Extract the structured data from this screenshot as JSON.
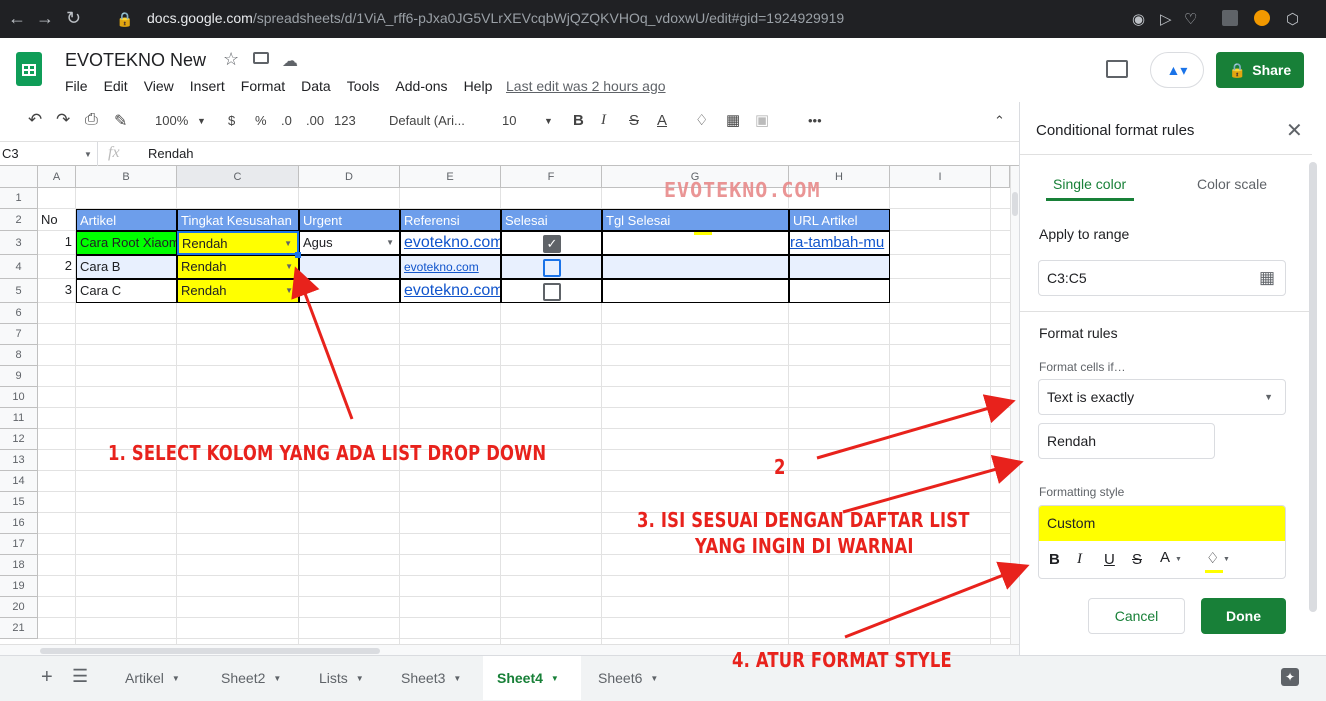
{
  "browser": {
    "url_domain": "docs.google.com",
    "url_path": "/spreadsheets/d/1ViA_rff6-pJxa0JG5VLrXEVcqbWjQZQKVHOq_vdoxwU/edit#gid=1924929919"
  },
  "header": {
    "title": "EVOTEKNO New",
    "menus": [
      "File",
      "Edit",
      "View",
      "Insert",
      "Format",
      "Data",
      "Tools",
      "Add-ons",
      "Help"
    ],
    "last_edit": "Last edit was 2 hours ago",
    "share_label": "Share"
  },
  "toolbar": {
    "zoom": "100%",
    "currency": "$",
    "percent": "%",
    "dec_less": ".0",
    "dec_more": ".00",
    "more_formats": "123",
    "font": "Default (Ari...",
    "font_size": "10",
    "bold": "B",
    "italic": "I",
    "strike": "S",
    "text_color": "A",
    "more": "•••"
  },
  "formula_bar": {
    "cell_ref": "C3",
    "fx": "fx",
    "value": "Rendah"
  },
  "grid": {
    "columns": [
      "A",
      "B",
      "C",
      "D",
      "E",
      "F",
      "G",
      "H",
      "I"
    ],
    "rows": [
      "1",
      "2",
      "3",
      "4",
      "5",
      "6",
      "7",
      "8",
      "9",
      "10",
      "11",
      "12",
      "13",
      "14",
      "15",
      "16",
      "17",
      "18",
      "19",
      "20",
      "21"
    ],
    "r2": {
      "a": "No",
      "b": "Artikel",
      "c": "Tingkat Kesusahan",
      "d": "Urgent",
      "e": "Referensi",
      "f": "Selesai",
      "g": "Tgl Selesai",
      "h": "URL Artikel"
    },
    "r3": {
      "a": "1",
      "b": "Cara Root Xiaomi",
      "c": "Rendah",
      "d": "Agus",
      "e": "evotekno.com",
      "h": "ra-tambah-mu"
    },
    "r4": {
      "a": "2",
      "b": "Cara B",
      "c": "Rendah",
      "e": "evotekno.com"
    },
    "r5": {
      "a": "3",
      "b": "Cara C",
      "c": "Rendah",
      "e": "evotekno.com"
    }
  },
  "panel": {
    "title": "Conditional format rules",
    "tab_single": "Single color",
    "tab_scale": "Color scale",
    "apply_label": "Apply to range",
    "range": "C3:C5",
    "format_rules": "Format rules",
    "cells_if": "Format cells if…",
    "condition": "Text is exactly",
    "value": "Rendah",
    "style_label": "Formatting style",
    "style_name": "Custom",
    "style_bold": "B",
    "style_italic": "I",
    "style_underline": "U",
    "style_strike": "S",
    "style_text_color": "A",
    "cancel": "Cancel",
    "done": "Done"
  },
  "tabs": [
    "Artikel",
    "Sheet2",
    "Lists",
    "Sheet3",
    "Sheet4",
    "Sheet6"
  ],
  "active_tab": "Sheet4",
  "annotations": {
    "a1": "1. SELECT KOLOM YANG ADA LIST DROP DOWN",
    "a2": "2",
    "a3_line1": "3. ISI SESUAI DENGAN DAFTAR LIST",
    "a3_line2": "YANG INGIN DI WARNAI",
    "a4": "4. ATUR FORMAT STYLE"
  },
  "watermark": "EVOTEKNO.COM",
  "colors": {
    "header_blue": "#6d9eeb",
    "highlight_yellow": "#ffff00",
    "green": "#00ff00",
    "accent_green": "#188038",
    "annotation_red": "#e8221c"
  }
}
